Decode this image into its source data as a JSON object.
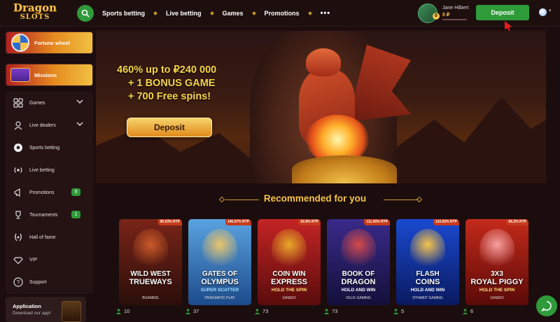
{
  "header": {
    "logo_line1": "Dragon",
    "logo_line2": "SLOTS",
    "nav": [
      "Sports betting",
      "Live betting",
      "Games",
      "Promotions"
    ],
    "more": "•••",
    "user_name": "Jane Hilbert",
    "balance": "0 ₽",
    "avatar_badge": "0",
    "deposit_label": "Deposit"
  },
  "sidebar": {
    "promos": [
      {
        "label": "Fortune wheel"
      },
      {
        "label": "Missions"
      }
    ],
    "menu": [
      {
        "label": "Games",
        "icon": "games-icon",
        "chevron": true
      },
      {
        "label": "Live dealers",
        "icon": "live-dealers-icon",
        "chevron": true
      },
      {
        "label": "Sports betting",
        "icon": "soccer-ball-icon"
      },
      {
        "label": "Live betting",
        "icon": "live-broadcast-icon"
      },
      {
        "label": "Promotions",
        "icon": "megaphone-icon",
        "count": "9"
      },
      {
        "label": "Tournaments",
        "icon": "trophy-icon",
        "count": "1"
      },
      {
        "label": "Hall of fame",
        "icon": "laurel-icon"
      },
      {
        "label": "VIP",
        "icon": "diamond-icon"
      },
      {
        "label": "Support",
        "icon": "question-icon"
      }
    ],
    "app": {
      "title": "Application",
      "subtitle": "Download our app!"
    }
  },
  "hero": {
    "line1": "460% up to ₽240 000",
    "line2": "+ 1 BONUS GAME",
    "line3": "+ 700 Free spins!",
    "deposit_label": "Deposit"
  },
  "recommended": {
    "title": "Recommended for you",
    "games": [
      {
        "t1": "WILD WEST",
        "t2": "TRUEWAYS",
        "sub": "",
        "provider": "BGAMING",
        "rtp": "95.03% RTP",
        "players": "10",
        "bg1": "#7a2418",
        "bg2": "#2a0e0a",
        "art": "#c95a2a",
        "sub_color": "#ffffff"
      },
      {
        "t1": "GATES OF",
        "t2": "OLYMPUS",
        "sub": "SUPER SCATTER",
        "provider": "PRAGMATIC PLAY",
        "rtp": "146.57% RTP",
        "players": "37",
        "bg1": "#5aa3e0",
        "bg2": "#1c4a8a",
        "art": "#e8c46a",
        "sub_color": "#9fe0ff"
      },
      {
        "t1": "COIN WIN",
        "t2": "EXPRESS",
        "sub": "HOLD THE SPIN",
        "provider": "GAMZIX",
        "rtp": "92.8% RTP",
        "players": "73",
        "bg1": "#c42424",
        "bg2": "#5a0c0c",
        "art": "#e8a82a",
        "sub_color": "#ffe27a"
      },
      {
        "t1": "BOOK OF",
        "t2": "DRAGON",
        "sub": "HOLD AND WIN",
        "provider": "FELIX GAMING",
        "rtp": "111.65% RTP",
        "players": "73",
        "bg1": "#3a2a8a",
        "bg2": "#12103a",
        "art": "#d44a4a",
        "sub_color": "#ffffff"
      },
      {
        "t1": "FLASH",
        "t2": "COINS",
        "sub": "HOLD AND WIN",
        "provider": "DYNABIT GAMING",
        "rtp": "110.62% RTP",
        "players": "5",
        "bg1": "#1a4ad0",
        "bg2": "#0a1a60",
        "art": "#f6c34a",
        "sub_color": "#ffffff"
      },
      {
        "t1": "3X3",
        "t2": "ROYAL PIGGY",
        "sub": "HOLD THE SPIN",
        "provider": "GAMZIX",
        "rtp": "96.2% RTP",
        "players": "6",
        "bg1": "#c42a1a",
        "bg2": "#5a0a08",
        "art": "#f6a0a0",
        "sub_color": "#ffe27a"
      }
    ]
  },
  "colors": {
    "accent_green": "#2f9a3a",
    "gold": "#f6c34a",
    "bg": "#1b0d0d"
  }
}
